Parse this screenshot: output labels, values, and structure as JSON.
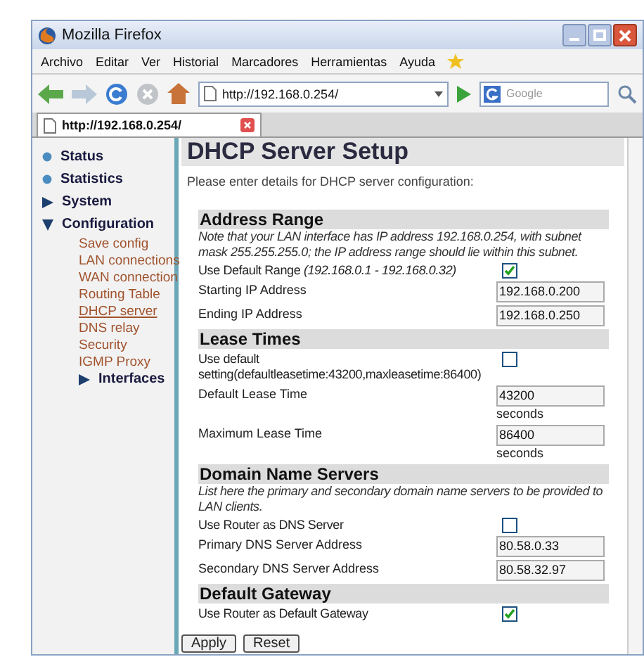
{
  "window": {
    "title": "Mozilla Firefox"
  },
  "menu": [
    "Archivo",
    "Editar",
    "Ver",
    "Historial",
    "Marcadores",
    "Herramientas",
    "Ayuda"
  ],
  "address_bar": {
    "value": "http://192.168.0.254/"
  },
  "search": {
    "placeholder": "Google"
  },
  "tabs": [
    {
      "label": "http://192.168.0.254/",
      "selected": true
    }
  ],
  "sidebar": {
    "items": [
      {
        "label": "Status",
        "kind": "leaf"
      },
      {
        "label": "Statistics",
        "kind": "leaf"
      },
      {
        "label": "System",
        "kind": "folder",
        "expanded": false
      },
      {
        "label": "Configuration",
        "kind": "folder",
        "expanded": true,
        "children": [
          {
            "label": "Save config",
            "kind": "link",
            "selected": false
          },
          {
            "label": "LAN connections",
            "kind": "link",
            "selected": false
          },
          {
            "label": "WAN connection",
            "kind": "link",
            "selected": false
          },
          {
            "label": "Routing Table",
            "kind": "link",
            "selected": false
          },
          {
            "label": "DHCP server",
            "kind": "link",
            "selected": true
          },
          {
            "label": "DNS relay",
            "kind": "link",
            "selected": false
          },
          {
            "label": "Security",
            "kind": "link",
            "selected": false
          },
          {
            "label": "IGMP Proxy",
            "kind": "link",
            "selected": false
          },
          {
            "label": "Interfaces",
            "kind": "folder",
            "expanded": false
          }
        ]
      }
    ]
  },
  "page": {
    "title": "DHCP Server Setup",
    "intro": "Please enter details for DHCP server configuration:"
  },
  "sections": [
    {
      "title": "Address Range",
      "rows": [
        {
          "kind": "note",
          "text": "Note that your LAN interface has IP address 192.168.0.254, with subnet mask 255.255.255.0; the IP address range should lie within this subnet."
        },
        {
          "kind": "checkbox",
          "label": "Use Default Range *(192.168.0.1 - 192.168.0.32)*",
          "checked": true
        },
        {
          "kind": "input",
          "label": "Starting IP Address",
          "value": "192.168.0.200"
        },
        {
          "kind": "input",
          "label": "Ending IP Address",
          "value": "192.168.0.250"
        }
      ]
    },
    {
      "title": "Lease Times",
      "rows": [
        {
          "kind": "checkbox",
          "label": "Use default setting(defaultleasetime:43200,maxleasetime:86400)",
          "checked": false
        },
        {
          "kind": "input",
          "label": "Default Lease Time",
          "value": "43200",
          "unit": "seconds"
        },
        {
          "kind": "input",
          "label": "Maximum Lease Time",
          "value": "86400",
          "unit": "seconds"
        }
      ]
    },
    {
      "title": "Domain Name Servers",
      "rows": [
        {
          "kind": "note",
          "text": "List here the primary and secondary domain name servers to be provided to LAN clients."
        },
        {
          "kind": "checkbox",
          "label": "Use Router as DNS Server",
          "checked": false
        },
        {
          "kind": "input",
          "label": "Primary DNS Server Address",
          "value": "80.58.0.33"
        },
        {
          "kind": "input",
          "label": "Secondary DNS Server Address",
          "value": "80.58.32.97"
        }
      ]
    },
    {
      "title": "Default Gateway",
      "rows": [
        {
          "kind": "checkbox",
          "label": "Use Router as Default Gateway",
          "checked": true
        }
      ]
    }
  ],
  "buttons": [
    "Apply",
    "Reset"
  ]
}
